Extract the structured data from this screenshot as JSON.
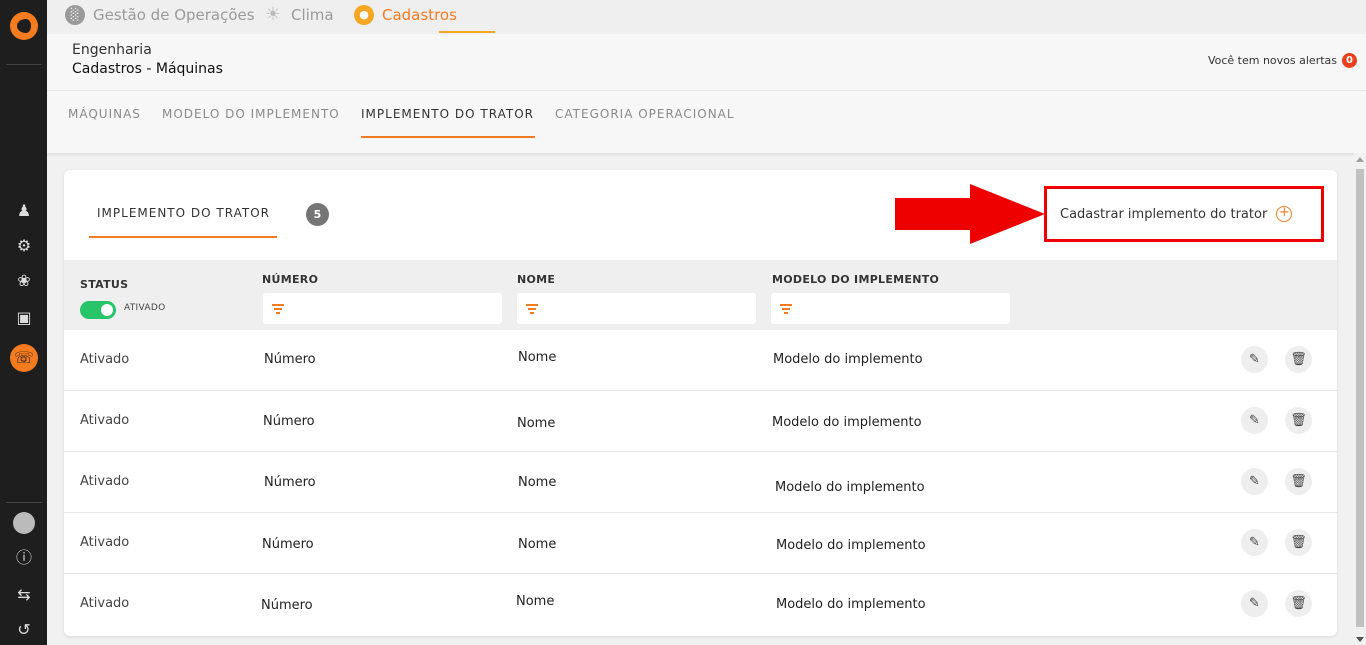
{
  "app_tabs": [
    {
      "label": "Gestão de Operações",
      "icon": "chart-icon"
    },
    {
      "label": "Clima",
      "icon": "sun-icon"
    },
    {
      "label": "Cadastros",
      "icon": "user-icon",
      "active": true
    }
  ],
  "header": {
    "breadcrumb_top": "Engenharia",
    "breadcrumb_title": "Cadastros - Máquinas",
    "alerts_text": "Você tem novos alertas",
    "alerts_count": "0"
  },
  "subnav": {
    "tabs": [
      "MÁQUINAS",
      "MODELO DO IMPLEMENTO",
      "IMPLEMENTO DO TRATOR",
      "CATEGORIA OPERACIONAL"
    ],
    "active_index": 2
  },
  "card": {
    "tab_label": "IMPLEMENTO DO TRATOR",
    "count": "5",
    "create_label": "Cadastrar implemento do trator"
  },
  "table": {
    "columns": {
      "status": "STATUS",
      "numero": "NÚMERO",
      "nome": "NOME",
      "modelo": "MODELO DO IMPLEMENTO"
    },
    "status_filter_label": "ATIVADO",
    "rows": [
      {
        "status": "Ativado",
        "numero": "Número",
        "nome": "Nome",
        "modelo": "Modelo do implemento"
      },
      {
        "status": "Ativado",
        "numero": "Número",
        "nome": "Nome",
        "modelo": "Modelo do implemento"
      },
      {
        "status": "Ativado",
        "numero": "Número",
        "nome": "Nome",
        "modelo": "Modelo do implemento"
      },
      {
        "status": "Ativado",
        "numero": "Número",
        "nome": "Nome",
        "modelo": "Modelo do implemento"
      },
      {
        "status": "Ativado",
        "numero": "Número",
        "nome": "Nome",
        "modelo": "Modelo do implemento"
      }
    ]
  },
  "colors": {
    "accent": "#f47b20",
    "toggle_on": "#27c46a",
    "highlight": "#ee0000",
    "sidebar": "#1e1e1e"
  }
}
